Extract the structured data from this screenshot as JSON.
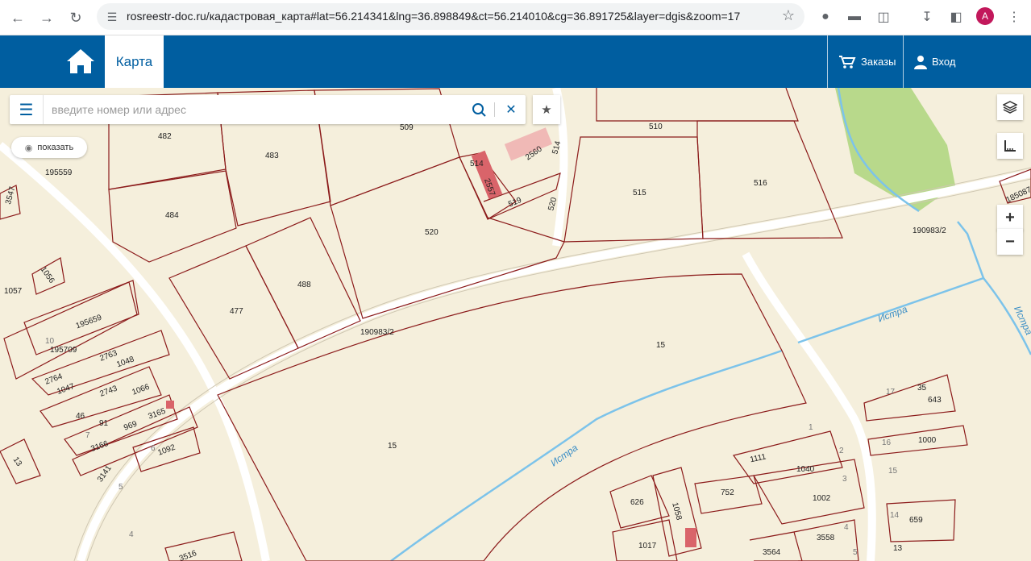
{
  "browser": {
    "url": "rosreestr-doc.ru/кадастровая_карта#lat=56.214341&lng=36.898849&ct=56.214010&cg=36.891725&layer=dgis&zoom=17",
    "profile_initial": "A"
  },
  "header": {
    "map_tab": "Карта",
    "orders": "Заказы",
    "login": "Вход"
  },
  "search": {
    "placeholder": "введите номер или адрес"
  },
  "show_button": "показать",
  "zoom": {
    "in": "+",
    "out": "−"
  },
  "colors": {
    "header": "#005ea0",
    "map_bg": "#f5efdc",
    "parcel_line": "#8b1a1a",
    "river": "#7cc3ea",
    "park": "#b8d98b"
  },
  "map_labels": {
    "l482": "482",
    "l483": "483",
    "l509": "509",
    "l510": "510",
    "l515": "515",
    "l516": "516",
    "l484": "484",
    "l520a": "520",
    "l520b": "520",
    "l514a": "514",
    "l514b": "514",
    "l2560": "2560",
    "l2557": "2557",
    "l519": "519",
    "l195559": "195559",
    "l3547": "3547",
    "l1056": "1056",
    "l1057": "1057",
    "l477": "477",
    "l488": "488",
    "l190983a": "190983/2",
    "l190983b": "190983/2",
    "l185087": "185087",
    "l15a": "15",
    "l15b": "15",
    "l195659": "195659",
    "l195709": "195709",
    "l10": "10",
    "l2763": "2763",
    "l1048": "1048",
    "l2764": "2764",
    "l1047": "1047",
    "l2743": "2743",
    "l1066": "1066",
    "l46": "46",
    "l91": "91",
    "l969": "969",
    "l3165": "3165",
    "l7": "7",
    "l3166": "3166",
    "l1092": "1092",
    "l6": "6",
    "l13": "13",
    "l3141": "3141",
    "l5": "5",
    "l4": "4",
    "l3516": "3516",
    "l35": "35",
    "l643": "643",
    "l17": "17",
    "l1000": "1000",
    "l16": "16",
    "l1": "1",
    "l1111": "1111",
    "l1040": "1040",
    "l2": "2",
    "l752": "752",
    "l3": "3",
    "l1002": "1002",
    "l626": "626",
    "l1058": "1058",
    "l15c": "15",
    "l14": "14",
    "l659": "659",
    "l1017": "1017",
    "l3558": "3558",
    "l3564": "3564",
    "l13b": "13",
    "l4b": "4",
    "l5b": "5",
    "istra1": "Истра",
    "istra2": "Истра",
    "istra3": "Истра"
  }
}
